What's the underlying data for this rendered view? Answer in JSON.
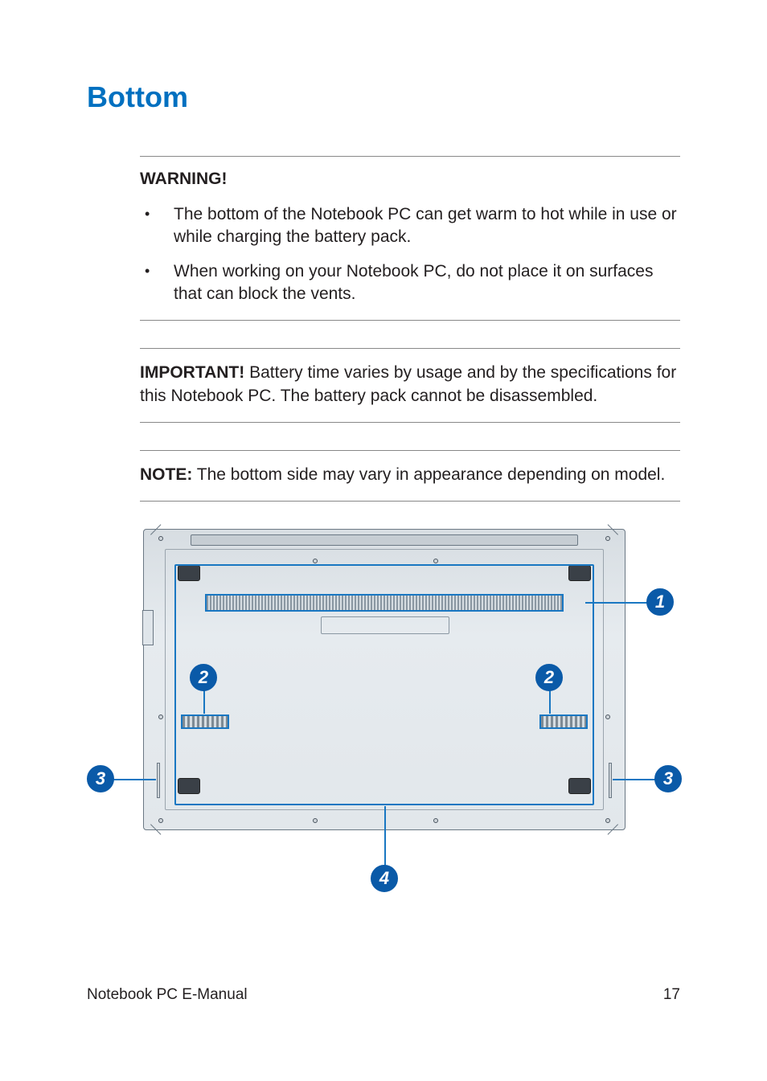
{
  "heading": "Bottom",
  "warning": {
    "label": "WARNING!",
    "bullets": [
      "The bottom of the Notebook PC can get warm to hot while in use or while charging the battery pack.",
      "When working on your Notebook PC, do not place it on surfaces that can block the vents."
    ]
  },
  "important": {
    "label": "IMPORTANT!",
    "text": " Battery time varies by usage and by the specifications for this Notebook PC. The battery pack cannot be disassembled."
  },
  "note": {
    "label": "NOTE:",
    "text": " The bottom side may vary in appearance depending on model."
  },
  "callouts": {
    "1": "1",
    "2": "2",
    "3": "3",
    "4": "4"
  },
  "footer": {
    "title": "Notebook PC E-Manual",
    "page": "17"
  }
}
